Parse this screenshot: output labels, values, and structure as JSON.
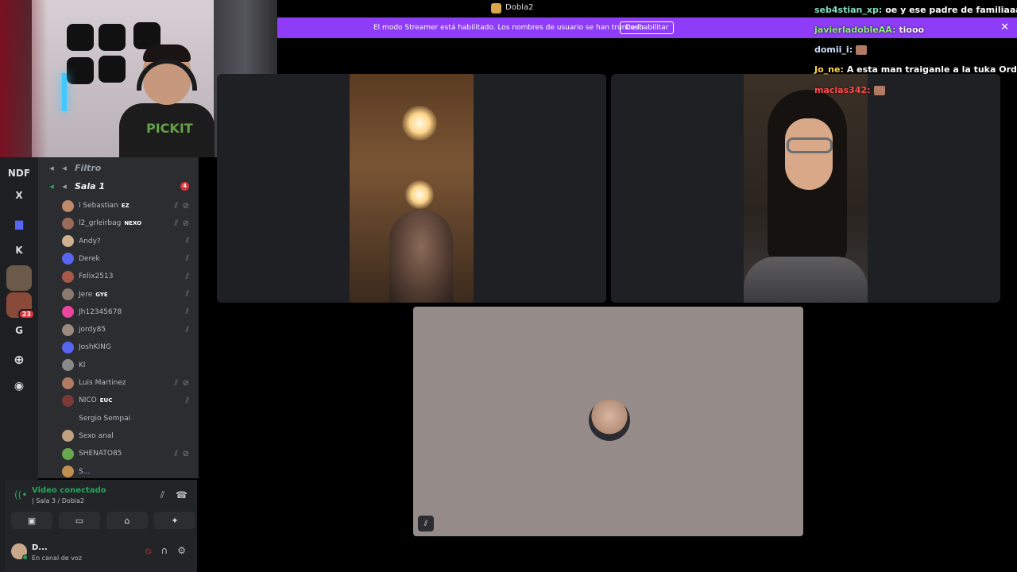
{
  "window": {
    "title": "Dobla2"
  },
  "banner": {
    "text": "El modo Streamer está habilitado. Los nombres de usuario se han truncado.",
    "button": "Deshabilitar",
    "close": "✕"
  },
  "webcam": {
    "shirt_text": "PICKIT"
  },
  "rail": {
    "items": [
      {
        "label": "NDF"
      },
      {
        "label": "X"
      },
      {
        "label": "K"
      },
      {
        "label": "G"
      }
    ],
    "badge": "23"
  },
  "channels": {
    "filter_channel": "Filtro",
    "active_channel": "Sala 1",
    "active_count": "4",
    "members": [
      {
        "name": "l Sebastian",
        "tag": "EZ",
        "color": "#c08a6a"
      },
      {
        "name": "l2_grleirbag",
        "tag": "NEXO",
        "color": "#9a6b5a"
      },
      {
        "name": "Andy?",
        "tag": "",
        "color": "#d0b090"
      },
      {
        "name": "Derek",
        "tag": "",
        "color": "#5865f2"
      },
      {
        "name": "Felix2513",
        "tag": "",
        "color": "#a85a4a"
      },
      {
        "name": "Jere",
        "tag": "GYE",
        "color": "#8a7a70"
      },
      {
        "name": "Jh12345678",
        "tag": "",
        "color": "#eb459e"
      },
      {
        "name": "jordy85",
        "tag": "",
        "color": "#9a8a80"
      },
      {
        "name": "JoshKING",
        "tag": "",
        "color": "#5865f2"
      },
      {
        "name": "Kl",
        "tag": "",
        "color": "#8a8a8a"
      },
      {
        "name": "Luis Martinez",
        "tag": "",
        "color": "#b07a63"
      },
      {
        "name": "NICO",
        "tag": "EUC",
        "color": "#7a3a3a"
      },
      {
        "name": "Sergio Sempai",
        "tag": "",
        "color": "#2b2d31"
      },
      {
        "name": "Sexo anal",
        "tag": "",
        "color": "#c0a080"
      },
      {
        "name": "SHENATO85",
        "tag": "",
        "color": "#6aa84f"
      },
      {
        "name": "S...",
        "tag": "",
        "color": "#c09050"
      }
    ]
  },
  "voice": {
    "status": "Video conectado",
    "location": "| Sala 3 / Dobla2",
    "user_name": "D...",
    "user_status": "En canal de voz"
  },
  "chat": [
    {
      "user": "seb4stian_xp:",
      "message": "oe y ese padre de familiaaaaa",
      "color": "#7fe0c4"
    },
    {
      "user": "javierladobleAA:",
      "message": "tiooo",
      "color": "#8ef07a"
    },
    {
      "user": "domii_i:",
      "message": "",
      "color": "#cfe0ff"
    },
    {
      "user": "Jo_ne:",
      "message": "A esta man traiganle a la tuka Ordóñez",
      "color": "#ffd34d"
    },
    {
      "user": "macias342:",
      "message": "",
      "color": "#ff4d4d"
    }
  ],
  "colors": {
    "accent": "#8e3cf7",
    "connected": "#23a55a",
    "danger": "#da373c",
    "discord_blurple": "#5865f2"
  }
}
